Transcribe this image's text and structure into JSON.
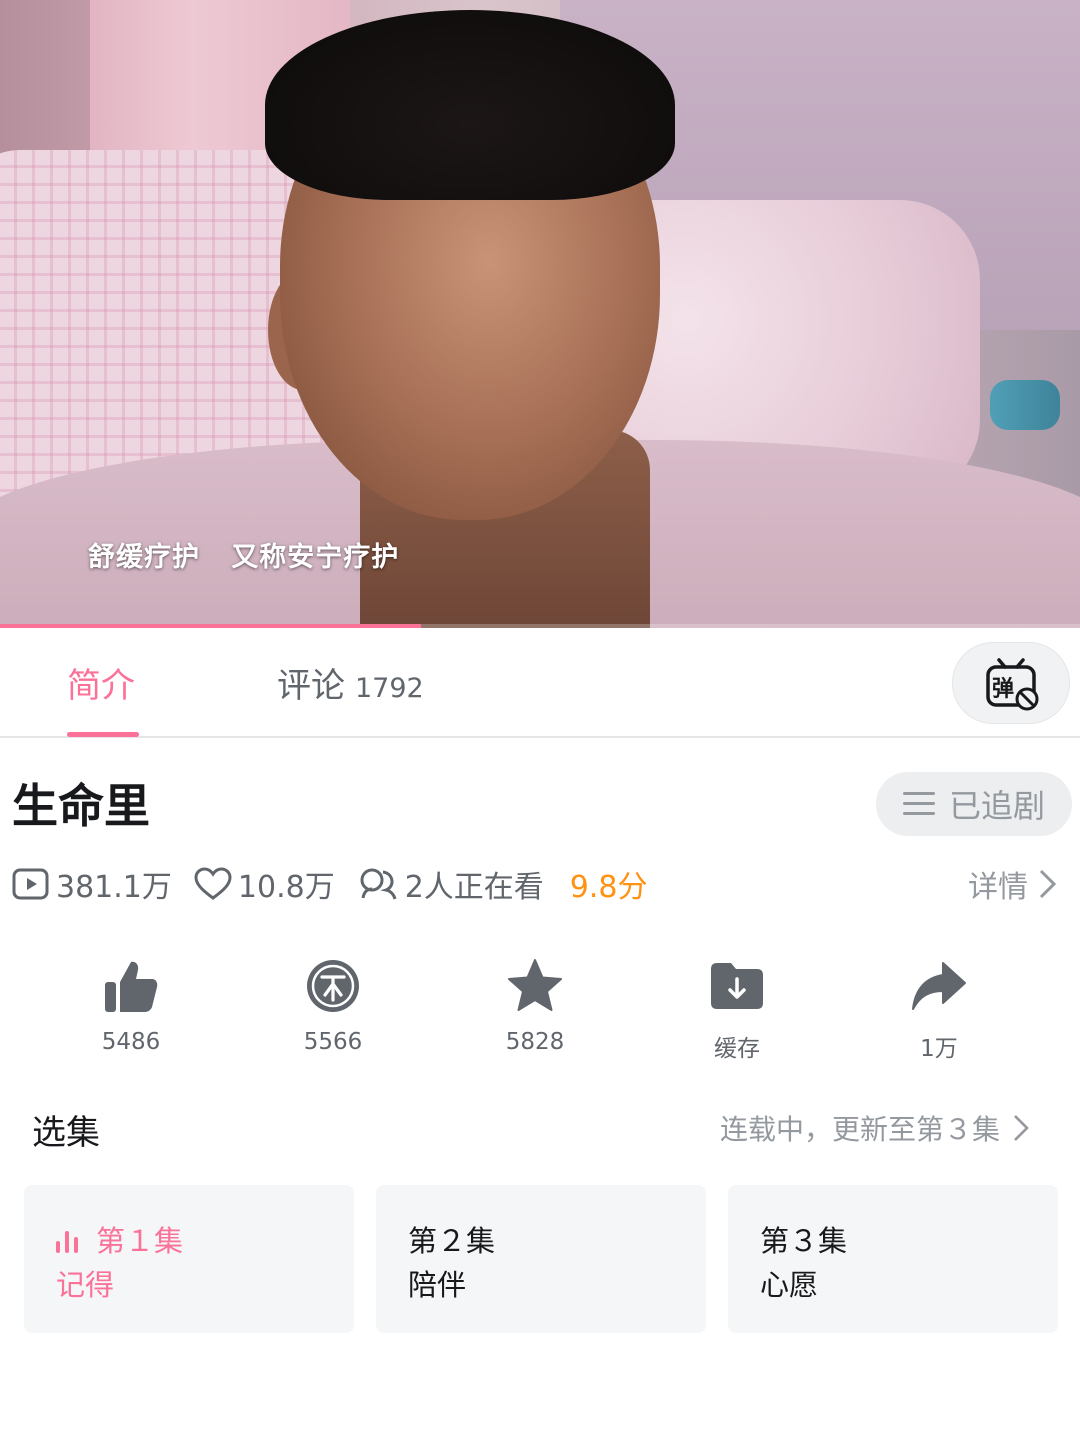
{
  "video": {
    "subtitle": "舒缓疗护   又称安宁疗护",
    "progress": 0.39
  },
  "tabs": {
    "intro_label": "简介",
    "comments_label": "评论",
    "comments_count": "1792",
    "danmaku_icon": "danmaku-off-icon"
  },
  "title": "生命里",
  "follow_label": "已追剧",
  "stats": {
    "views": "381.1万",
    "likes": "10.8万",
    "watching": "2人正在看",
    "rating": "9.8分",
    "detail_label": "详情"
  },
  "actions": [
    {
      "icon": "thumbs-up-icon",
      "label": "5486"
    },
    {
      "icon": "coin-icon",
      "label": "5566"
    },
    {
      "icon": "star-icon",
      "label": "5828"
    },
    {
      "icon": "download-folder-icon",
      "label": "缓存"
    },
    {
      "icon": "share-icon",
      "label": "1万"
    }
  ],
  "episodes": {
    "title": "选集",
    "status": "连载中，更新至第３集",
    "items": [
      {
        "number": "第１集",
        "name": "记得",
        "active": true
      },
      {
        "number": "第２集",
        "name": "陪伴",
        "active": false
      },
      {
        "number": "第３集",
        "name": "心愿",
        "active": false
      }
    ]
  },
  "colors": {
    "accent": "#fb7299",
    "rating": "#ff9212",
    "secondary_text": "#61666d",
    "muted_text": "#9499a0",
    "card_bg": "#f4f6f7"
  }
}
